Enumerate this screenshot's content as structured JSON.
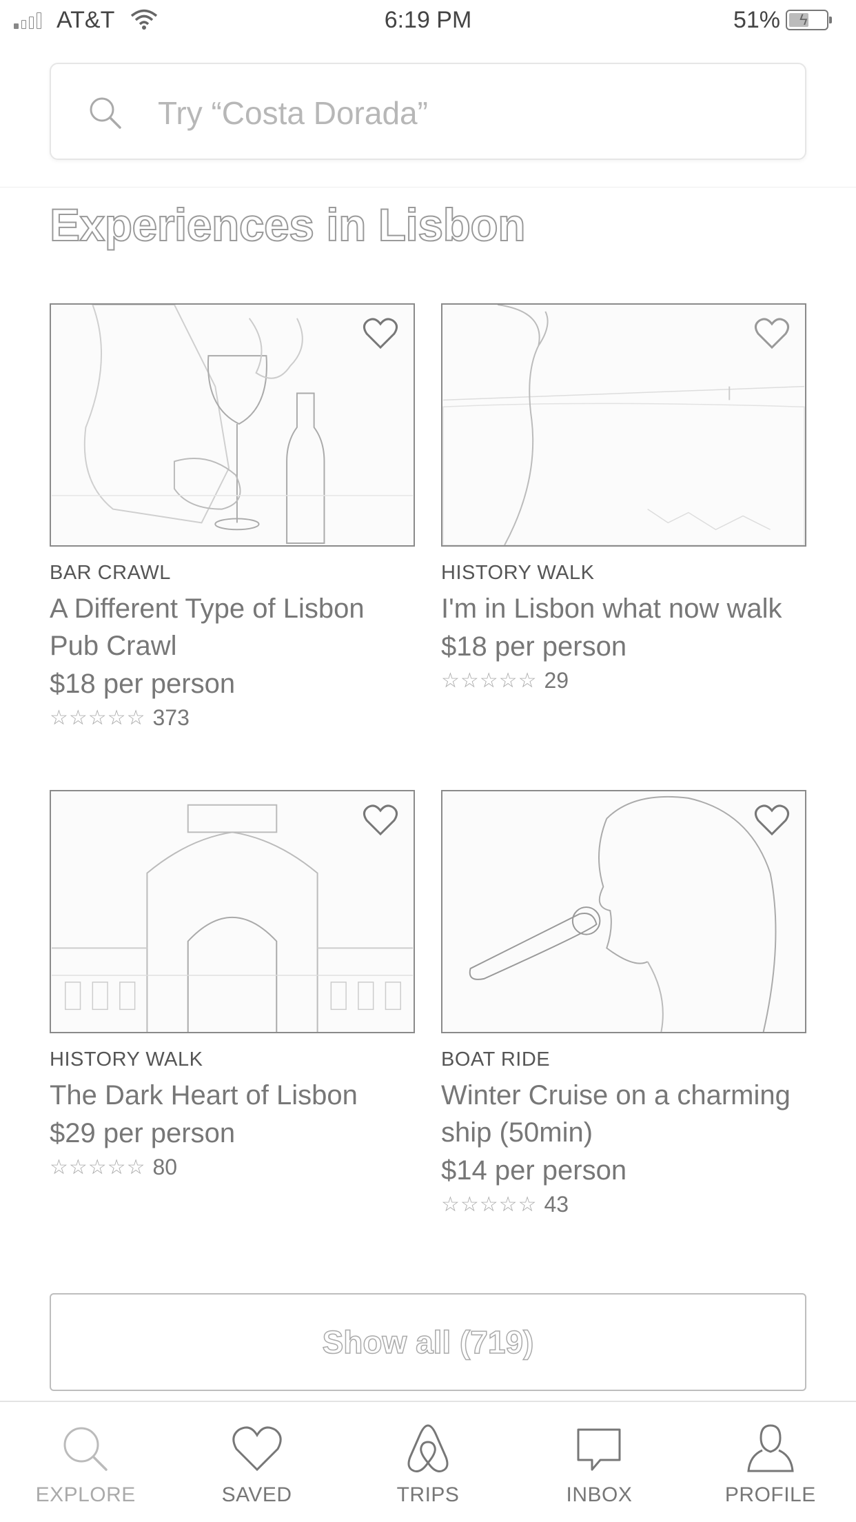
{
  "status_bar": {
    "carrier": "AT&T",
    "time": "6:19 PM",
    "battery": "51%"
  },
  "search": {
    "placeholder": "Try “Costa Dorada”"
  },
  "section": {
    "title": "Experiences in Lisbon"
  },
  "cards": [
    {
      "category": "BAR CRAWL",
      "title": "A Different Type of Lisbon Pub Crawl",
      "price": "$18 per person",
      "stars": "☆☆☆☆☆",
      "reviews": "373"
    },
    {
      "category": "HISTORY WALK",
      "title": "I'm in Lisbon what now walk",
      "price": "$18 per person",
      "stars": "☆☆☆☆☆",
      "reviews": "29"
    },
    {
      "category": "HISTORY WALK",
      "title": "The Dark Heart of Lisbon",
      "price": "$29 per person",
      "stars": "☆☆☆☆☆",
      "reviews": "80"
    },
    {
      "category": "BOAT RIDE",
      "title": "Winter Cruise on a charming ship (50min)",
      "price": "$14 per person",
      "stars": "☆☆☆☆☆",
      "reviews": "43"
    }
  ],
  "show_all": {
    "label": "Show all (719)"
  },
  "tabs": [
    {
      "label": "EXPLORE",
      "icon": "search-icon",
      "active": true
    },
    {
      "label": "SAVED",
      "icon": "heart-icon",
      "active": false
    },
    {
      "label": "TRIPS",
      "icon": "airbnb-logo-icon",
      "active": false
    },
    {
      "label": "INBOX",
      "icon": "chat-bubble-icon",
      "active": false
    },
    {
      "label": "PROFILE",
      "icon": "person-icon",
      "active": false
    }
  ]
}
